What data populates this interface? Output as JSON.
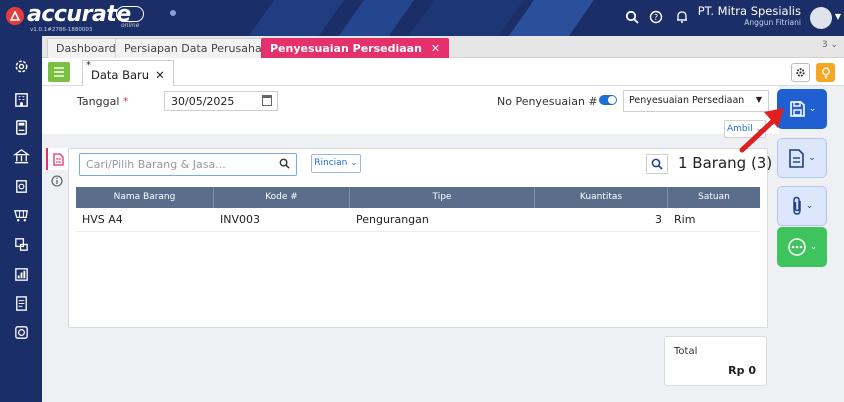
{
  "header": {
    "app_name": "accurate",
    "edition": "online",
    "version": "v1.0.1#2786-1880003",
    "company_name": "PT. Mitra Spesialis",
    "user_name": "Anggun Fitriani",
    "icons": [
      "search-icon",
      "help-icon",
      "bell-icon",
      "avatar"
    ]
  },
  "sidebar": {
    "items": [
      "gear-icon",
      "building-icon",
      "calculator-icon",
      "bank-icon",
      "receivable-icon",
      "cart-icon",
      "inventory-icon",
      "report-icon",
      "tax-icon",
      "settings-shield-icon"
    ]
  },
  "tabs": {
    "items": [
      {
        "label": "Dashboard"
      },
      {
        "label": "Persiapan Data Perusahaan"
      },
      {
        "label": "Penyesuaian Persediaan",
        "close": "✕",
        "active": true
      }
    ],
    "overflow": "3 ⌄"
  },
  "doc_tab": {
    "marker": "*",
    "label": "Data Baru",
    "close": "✕"
  },
  "form": {
    "date_label": "Tanggal",
    "required_mark": "*",
    "date_value": "30/05/2025",
    "no_label": "No Penyesuaian #",
    "type_value": "Penyesuaian Persediaan",
    "ambil_label": "Ambil ⌄"
  },
  "items": {
    "search_placeholder": "Cari/Pilih Barang & Jasa...",
    "rincian_label": "Rincian ⌄",
    "count_label": "1 Barang (3)",
    "columns": [
      "Nama Barang",
      "Kode #",
      "Tipe",
      "Kuantitas",
      "Satuan"
    ],
    "rows": [
      {
        "name": "HVS A4",
        "code": "INV003",
        "type": "Pengurangan",
        "qty": "3",
        "unit": "Rim"
      }
    ]
  },
  "total": {
    "label": "Total",
    "value": "Rp 0"
  },
  "colors": {
    "navy": "#1b2e68",
    "accent_pink": "#e6306b",
    "save_blue": "#1f5fd1",
    "green": "#3fc35c",
    "list_green": "#7bc043",
    "bulb_orange": "#f5a623",
    "arrow_red": "#e02020"
  }
}
